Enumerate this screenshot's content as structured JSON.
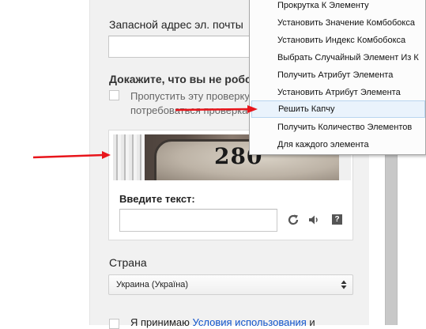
{
  "form": {
    "backup_email_label": "Запасной адрес эл. почты",
    "backup_email_value": "",
    "robot_title": "Докажите, что вы не робот",
    "skip_text_line1": "Пропустить эту проверку.",
    "skip_text_line2": "потребоваться проверка",
    "captcha_digits": "280",
    "captcha_prompt": "Введите текст:",
    "captcha_input_value": "",
    "help_glyph": "?",
    "country_label": "Страна",
    "country_value": "Украина (Україна)",
    "terms_prefix": "Я принимаю ",
    "terms_link": "Условия использования",
    "terms_suffix": " и"
  },
  "context_menu": {
    "items": [
      "Прокрутка К Элементу",
      "Установить Значение Комбобокса",
      "Установить Индекс Комбобокса",
      "Выбрать Случайный Элемент Из К",
      "Получить Атрибут Элемента",
      "Установить Атрибут Элемента",
      "Решить Капчу",
      "Получить Количество Элементов",
      "Для каждого элемента"
    ],
    "highlighted_index": 6
  },
  "icons": [
    "refresh-icon",
    "audio-icon",
    "help-icon",
    "select-arrows-icon"
  ],
  "colors": {
    "annotation_arrow": "#e8151b",
    "link": "#1155cc",
    "menu_highlight": "#eaf3fc"
  }
}
